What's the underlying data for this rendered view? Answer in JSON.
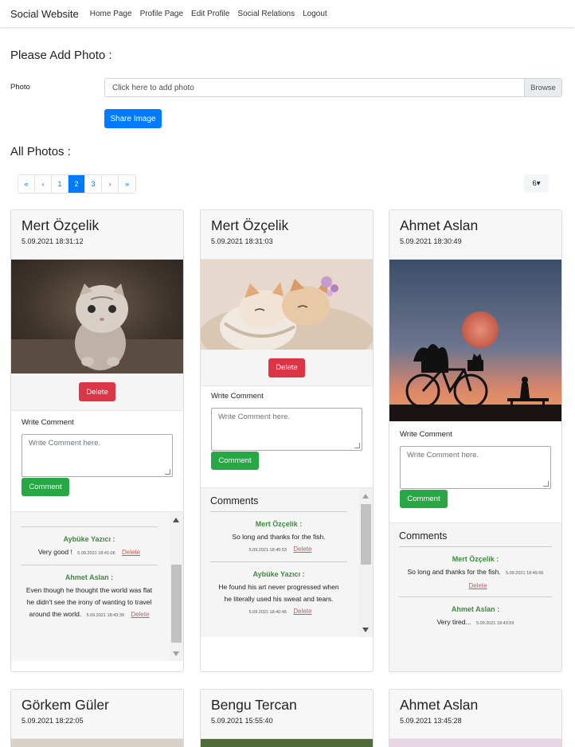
{
  "navbar": {
    "brand": "Social Website",
    "links": [
      "Home Page",
      "Profile Page",
      "Edit Profile",
      "Social Relations",
      "Logout"
    ]
  },
  "upload": {
    "title": "Please Add Photo :",
    "photo_label": "Photo",
    "file_placeholder": "Click here to add photo",
    "browse_label": "Browse",
    "share_label": "Share Image"
  },
  "photos_title": "All Photos :",
  "pagination": {
    "items": [
      "«",
      "‹",
      "1",
      "2",
      "3",
      "›",
      "»"
    ],
    "active": "2",
    "per_page": "6▾"
  },
  "cards": [
    {
      "name": "Mert Özçelik",
      "date": "5.09.2021 18:31:12",
      "image": "kitten-photo",
      "delete_label": "Delete",
      "write_label": "Write Comment",
      "textarea_placeholder": "Write Comment here.",
      "comment_label": "Comment",
      "comments": [
        {
          "author": "Aybüke Yazıcı :",
          "text": "Very good !",
          "date": "5.09.2021 18:41:06",
          "delete": "Delete"
        },
        {
          "author": "Ahmet Aslan :",
          "text": "Even though he thought the world was flat he didn't see the irony of wanting to travel around the world.",
          "date": "5.09.2021 18:43:39",
          "delete": "Delete"
        }
      ]
    },
    {
      "name": "Mert Özçelik",
      "date": "5.09.2021 18:31:03",
      "image": "two-kittens-photo",
      "delete_label": "Delete",
      "write_label": "Write Comment",
      "textarea_placeholder": "Write Comment here.",
      "comment_label": "Comment",
      "comments_title": "Comments",
      "comments": [
        {
          "author": "Mert Özçelik :",
          "text": "So long and thanks for the fish.",
          "date": "5.09.2021 18:45:53",
          "delete": "Delete"
        },
        {
          "author": "Aybüke Yazıcı :",
          "text": "He found his art never progressed when he literally used his sweat and tears.",
          "date": "5.09.2021 18:40:45",
          "delete": "Delete"
        }
      ]
    },
    {
      "name": "Ahmet Aslan",
      "date": "5.09.2021 18:30:49",
      "image": "sunset-bicycle-photo",
      "write_label": "Write Comment",
      "textarea_placeholder": "Write Comment here.",
      "comment_label": "Comment",
      "comments_title": "Comments",
      "comments": [
        {
          "author": "Mert Özçelik :",
          "text": "So long and thanks for the fish.",
          "date": "5.09.2021 18:45:56",
          "delete": "Delete"
        },
        {
          "author": "Ahmet Aslan :",
          "text": "Very tired...",
          "date": "5.09.2021 18:43:59"
        }
      ]
    },
    {
      "name": "Görkem Güler",
      "date": "5.09.2021 18:22:05"
    },
    {
      "name": "Bengu Tercan",
      "date": "5.09.2021 15:55:40"
    },
    {
      "name": "Ahmet Aslan",
      "date": "5.09.2021 13:45:28"
    }
  ]
}
